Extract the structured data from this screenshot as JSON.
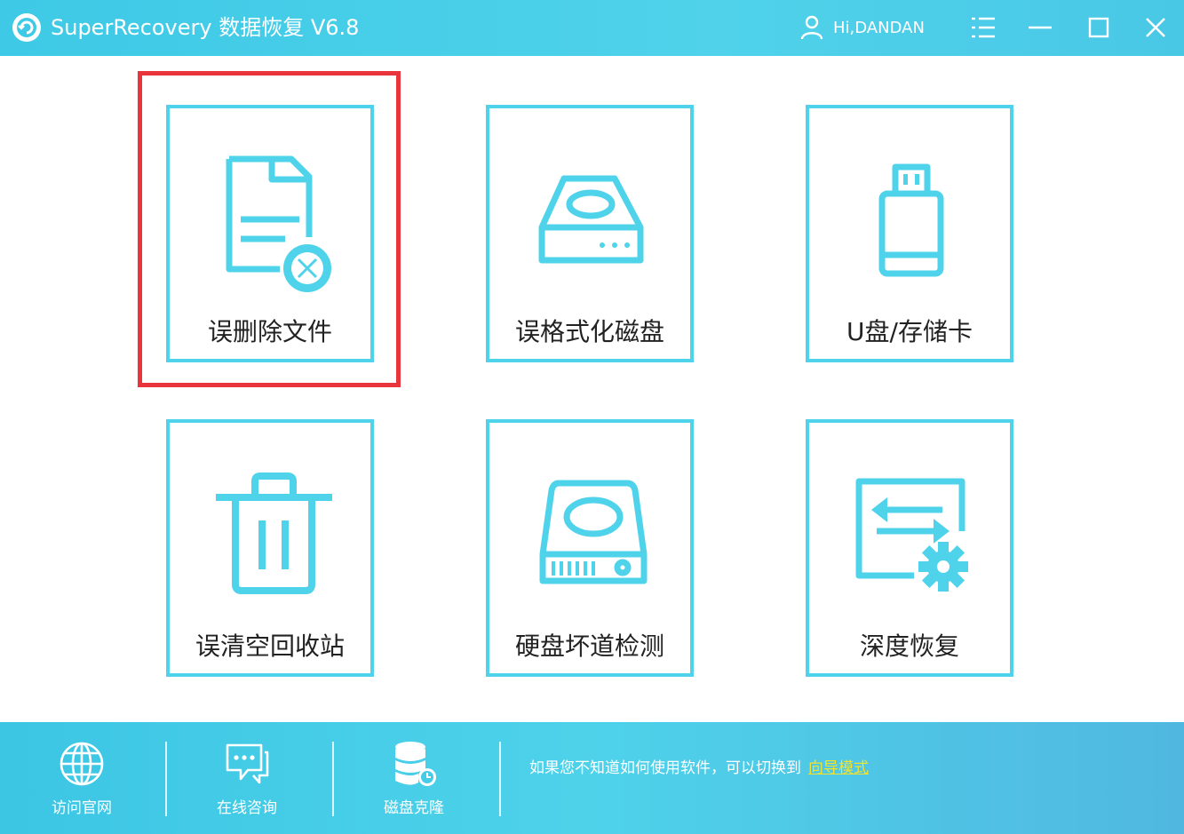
{
  "window": {
    "title": "SuperRecovery 数据恢复 V6.8",
    "user": "Hi,DANDAN",
    "controls": [
      "menu-icon",
      "minimize-icon",
      "maximize-icon",
      "close-icon"
    ]
  },
  "tiles": [
    {
      "label": "误删除文件",
      "icon": "deleted-file-icon",
      "highlighted": true
    },
    {
      "label": "误格式化磁盘",
      "icon": "disk-drive-icon"
    },
    {
      "label": "U盘/存储卡",
      "icon": "usb-drive-icon"
    },
    {
      "label": "误清空回收站",
      "icon": "trash-bin-icon"
    },
    {
      "label": "硬盘坏道检测",
      "icon": "hard-disk-check-icon"
    },
    {
      "label": "深度恢复",
      "icon": "deep-recovery-icon"
    }
  ],
  "bottom": {
    "tools": [
      {
        "label": "访问官网",
        "icon": "globe-icon"
      },
      {
        "label": "在线咨询",
        "icon": "chat-icon"
      },
      {
        "label": "磁盘克隆",
        "icon": "database-clone-icon"
      }
    ],
    "hint": "如果您不知道如何使用软件，可以切换到",
    "hint_link": "向导模式"
  },
  "colors": {
    "accent": "#4fd3ea",
    "highlight": "#e8343a",
    "link": "#f4e32b"
  }
}
